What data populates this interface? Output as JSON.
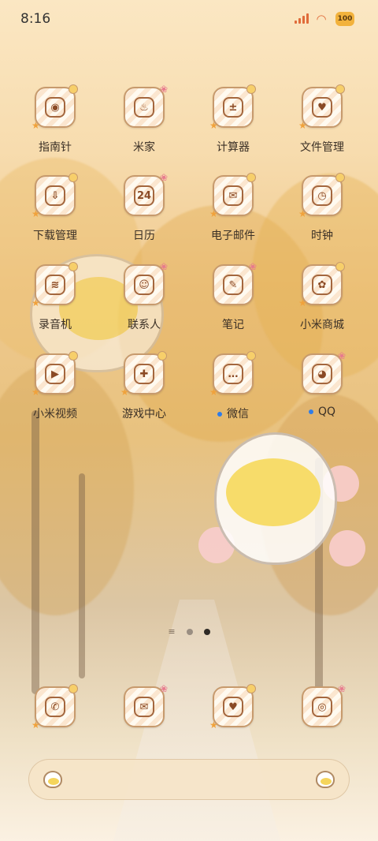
{
  "status_bar": {
    "time": "8:16",
    "battery": "100",
    "accent_color": "#e06b3a"
  },
  "apps": [
    {
      "label": "指南针",
      "icon": "compass-icon",
      "glyph": "◉"
    },
    {
      "label": "米家",
      "icon": "smart-home-icon",
      "glyph": "♨"
    },
    {
      "label": "计算器",
      "icon": "calculator-icon",
      "glyph": "±"
    },
    {
      "label": "文件管理",
      "icon": "folder-icon",
      "glyph": "♥"
    },
    {
      "label": "下载管理",
      "icon": "download-icon",
      "glyph": "⇩"
    },
    {
      "label": "日历",
      "icon": "calendar-icon",
      "glyph": "24"
    },
    {
      "label": "电子邮件",
      "icon": "email-icon",
      "glyph": "✉"
    },
    {
      "label": "时钟",
      "icon": "clock-icon",
      "glyph": "◷"
    },
    {
      "label": "录音机",
      "icon": "recorder-icon",
      "glyph": "≋"
    },
    {
      "label": "联系人",
      "icon": "contacts-icon",
      "glyph": "☺"
    },
    {
      "label": "笔记",
      "icon": "notes-icon",
      "glyph": "✎"
    },
    {
      "label": "小米商城",
      "icon": "mi-store-icon",
      "glyph": "✿"
    },
    {
      "label": "小米视频",
      "icon": "video-icon",
      "glyph": "▶"
    },
    {
      "label": "游戏中心",
      "icon": "game-center-icon",
      "glyph": "✚"
    },
    {
      "label": "微信",
      "icon": "wechat-icon",
      "glyph": "…",
      "new_dot": true
    },
    {
      "label": "QQ",
      "icon": "qq-icon",
      "glyph": "◕",
      "new_dot": true
    }
  ],
  "pager": {
    "pages": 2,
    "active_page": 2
  },
  "dock": [
    {
      "icon": "phone-icon",
      "glyph": "✆"
    },
    {
      "icon": "messages-icon",
      "glyph": "✉"
    },
    {
      "icon": "browser-icon",
      "glyph": "♥"
    },
    {
      "icon": "camera-icon",
      "glyph": "◎"
    }
  ],
  "search_bar": {
    "left_icon": "chick-assistant-icon",
    "right_icon": "chick-assistant-icon"
  }
}
